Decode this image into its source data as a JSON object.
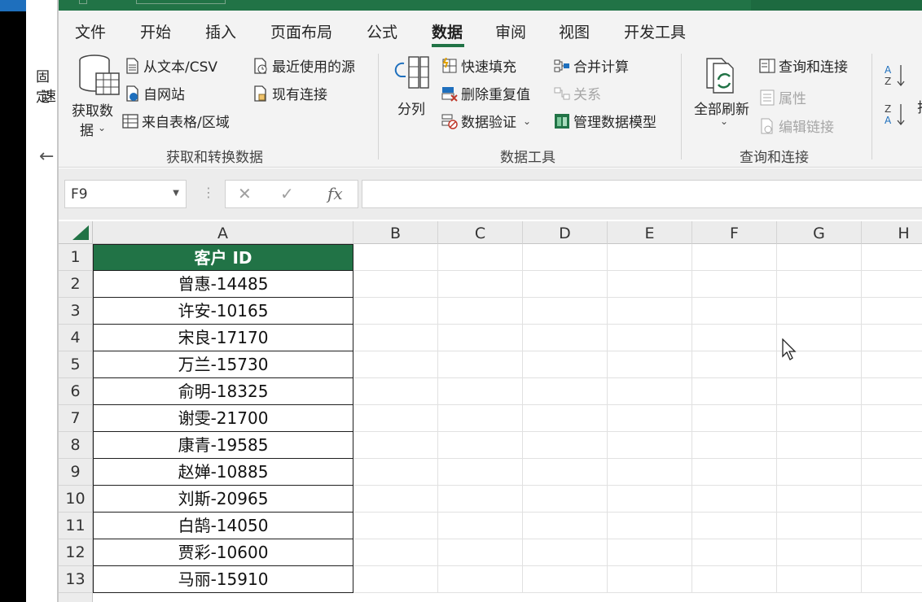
{
  "background_panel": {
    "line1": "固定",
    "line2": "速"
  },
  "ribbon_tabs": [
    "文件",
    "开始",
    "插入",
    "页面布局",
    "公式",
    "数据",
    "审阅",
    "视图",
    "开发工具"
  ],
  "active_tab": "数据",
  "ribbon": {
    "get_data": {
      "label_line1": "获取数",
      "label_line2": "据"
    },
    "from_text_csv": "从文本/CSV",
    "from_web": "自网站",
    "from_table": "来自表格/区域",
    "recent_sources": "最近使用的源",
    "existing_connections": "现有连接",
    "group_get_transform": "获取和转换数据",
    "text_to_columns": "分列",
    "flash_fill": "快速填充",
    "remove_duplicates": "删除重复值",
    "data_validation": "数据验证",
    "consolidate": "合并计算",
    "relationships": "关系",
    "manage_data_model": "管理数据模型",
    "group_data_tools": "数据工具",
    "refresh_all": "全部刷新",
    "queries_connections": "查询和连接",
    "properties": "属性",
    "edit_links": "编辑链接",
    "group_queries": "查询和连接",
    "sort_cut": "排"
  },
  "formula_bar": {
    "name_box": "F9",
    "cancel": "✕",
    "enter": "✓",
    "fx": "fx",
    "value": ""
  },
  "columns": [
    "A",
    "B",
    "C",
    "D",
    "E",
    "F",
    "G",
    "H"
  ],
  "rows": [
    "1",
    "2",
    "3",
    "4",
    "5",
    "6",
    "7",
    "8",
    "9",
    "10",
    "11",
    "12",
    "13"
  ],
  "table": {
    "header": "客户 ID",
    "values": [
      "曾惠-14485",
      "许安-10165",
      "宋良-17170",
      "万兰-15730",
      "俞明-18325",
      "谢雯-21700",
      "康青-19585",
      "赵婵-10885",
      "刘斯-20965",
      "白鹄-14050",
      "贾彩-10600",
      "马丽-15910"
    ]
  },
  "colors": {
    "excel_green": "#217346",
    "ribbon_bg": "#f3f3f3"
  }
}
